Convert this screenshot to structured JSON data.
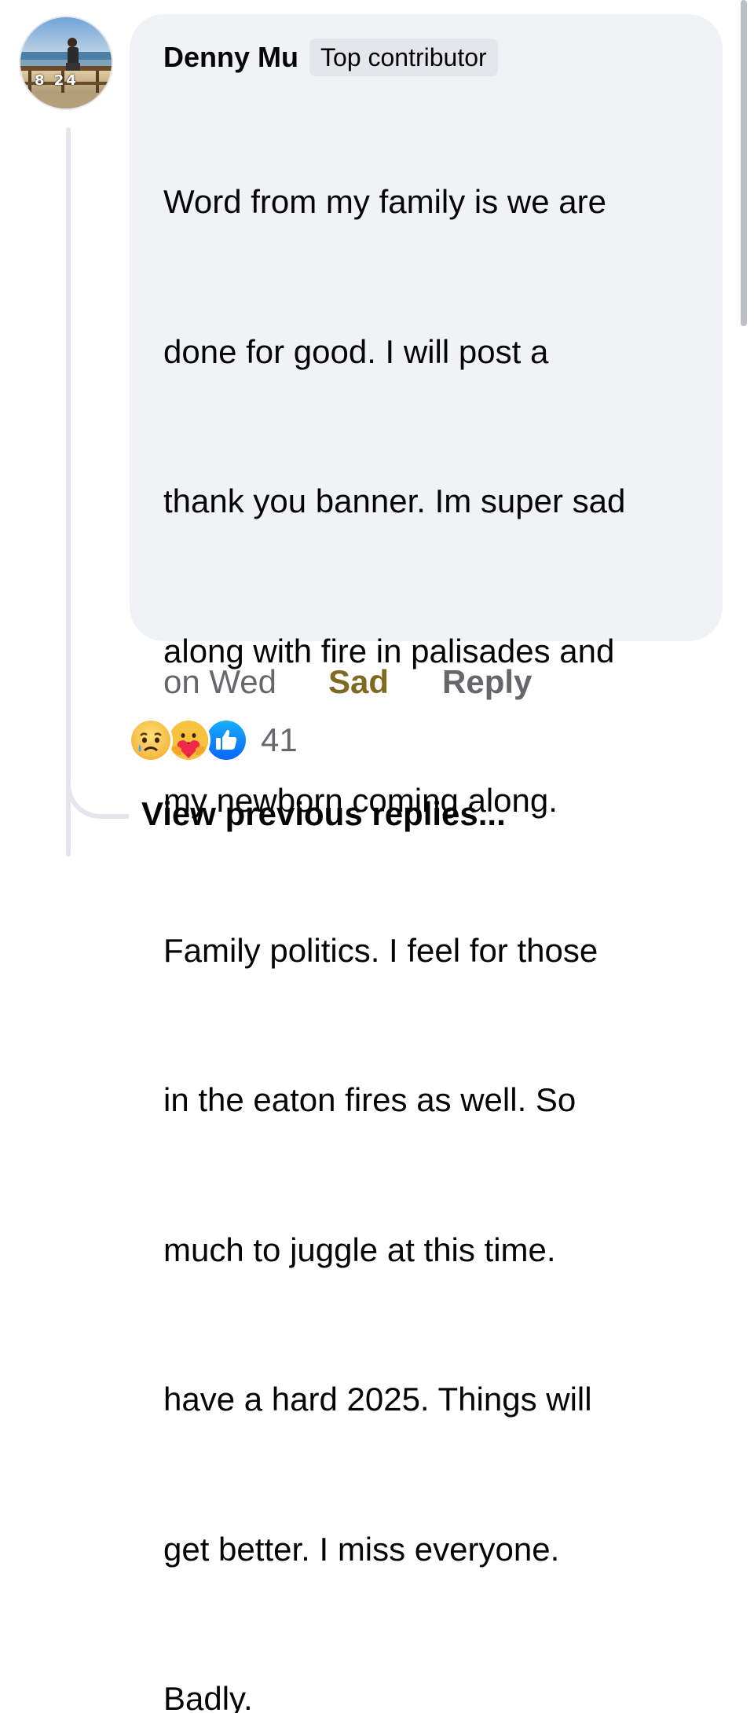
{
  "comment": {
    "author": "Denny Mu",
    "badge": "Top contributor",
    "avatar_overlay_text": "8 24",
    "text_lines": [
      "Word from my family is we are",
      "done for good. I will post a",
      "thank you banner. Im super sad",
      "along with fire in palisades and",
      "my newborn coming along.",
      "Family politics. I feel for those",
      "in the eaton fires as well. So",
      "much to juggle at this time.",
      "have a hard 2025. Things will",
      "get better. I miss everyone.",
      "Badly."
    ]
  },
  "actions": {
    "timestamp": "on Wed",
    "reaction_label": "Sad",
    "reply_label": "Reply"
  },
  "reactions": {
    "icons": [
      "sad-reaction-icon",
      "care-reaction-icon",
      "like-reaction-icon"
    ],
    "count": "41"
  },
  "footer": {
    "view_previous": "View previous replies..."
  },
  "colors": {
    "bubble_bg": "#f0f2f5",
    "sad_label": "#7e6b21",
    "secondary_text": "#65676b",
    "like_blue": "#1877f2"
  }
}
